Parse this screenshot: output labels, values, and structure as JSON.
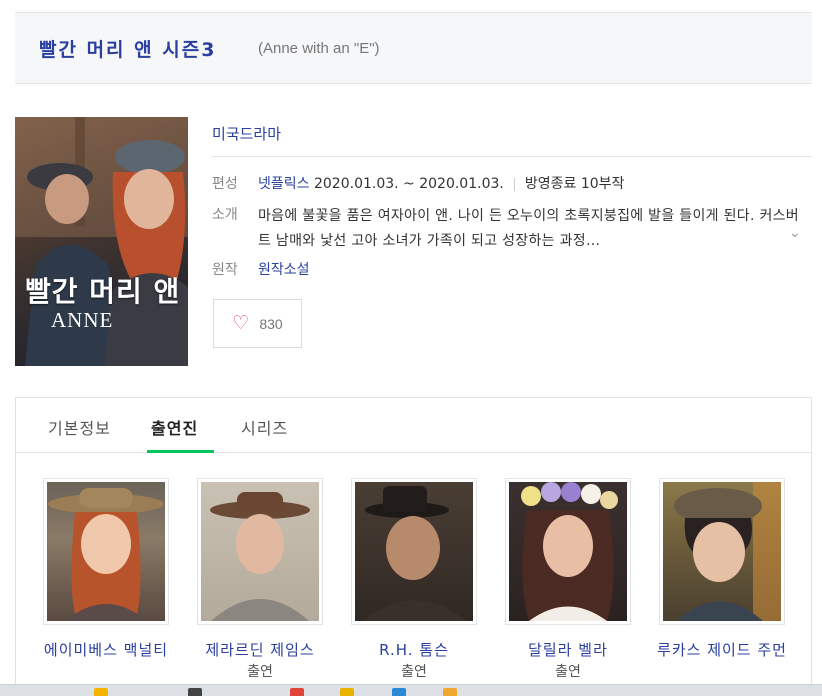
{
  "header": {
    "title": "빨간 머리 앤 시즌3",
    "subtitle": "(Anne with an \"E\")"
  },
  "poster": {
    "title_ko": "빨간 머리 앤",
    "title_en": "ANNE"
  },
  "info": {
    "genre": "미국드라마",
    "broadcast_label": "편성",
    "broadcaster": "넷플릭스",
    "period": "2020.01.03. ~ 2020.01.03.",
    "status": "방영종료 10부작",
    "synopsis_label": "소개",
    "synopsis": "마음에 불꽃을 품은 여자아이 앤. 나이 든 오누이의 초록지붕집에 발을 들이게 된다. 커스버트 남매와 낯선 고아 소녀가 가족이 되고 성장하는 과정…",
    "original_label": "원작",
    "original": "원작소설",
    "likes": "830"
  },
  "tabs": [
    "기본정보",
    "출연진",
    "시리즈"
  ],
  "cast": [
    {
      "name": "에이미베스 맥널티",
      "role": ""
    },
    {
      "name": "제라르딘 제임스",
      "role": "출연"
    },
    {
      "name": "R.H. 톰슨",
      "role": "출연"
    },
    {
      "name": "달릴라 벨라",
      "role": "출연"
    },
    {
      "name": "루카스 제이드 주먼",
      "role": ""
    }
  ],
  "colors": {
    "link": "#2a3f9e",
    "active_tab": "#03c75a",
    "heart": "#e9546b"
  }
}
